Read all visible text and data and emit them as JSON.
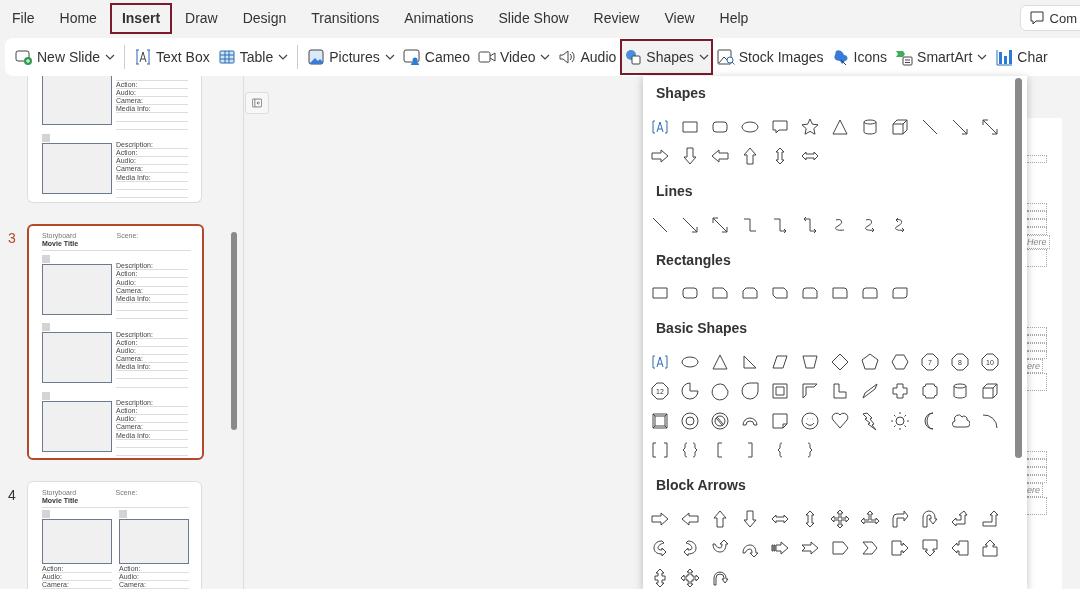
{
  "tabs": [
    {
      "label": "File",
      "selected": false
    },
    {
      "label": "Home",
      "selected": false
    },
    {
      "label": "Insert",
      "selected": true
    },
    {
      "label": "Draw",
      "selected": false
    },
    {
      "label": "Design",
      "selected": false
    },
    {
      "label": "Transitions",
      "selected": false
    },
    {
      "label": "Animations",
      "selected": false
    },
    {
      "label": "Slide Show",
      "selected": false
    },
    {
      "label": "Review",
      "selected": false
    },
    {
      "label": "View",
      "selected": false
    },
    {
      "label": "Help",
      "selected": false
    }
  ],
  "comments_button": {
    "label": "Com"
  },
  "ribbon": {
    "groups": [
      [
        {
          "label": "New Slide",
          "dropdown": true,
          "selected": false
        }
      ],
      [
        {
          "label": "Text Box",
          "dropdown": false,
          "selected": false
        },
        {
          "label": "Table",
          "dropdown": true,
          "selected": false
        }
      ],
      [
        {
          "label": "Pictures",
          "dropdown": true,
          "selected": false
        },
        {
          "label": "Cameo",
          "dropdown": false,
          "selected": false
        },
        {
          "label": "Video",
          "dropdown": true,
          "selected": false
        },
        {
          "label": "Audio",
          "dropdown": false,
          "selected": false
        },
        {
          "label": "Shapes",
          "dropdown": true,
          "selected": true
        },
        {
          "label": "Stock Images",
          "dropdown": false,
          "selected": false
        },
        {
          "label": "Icons",
          "dropdown": false,
          "selected": false
        },
        {
          "label": "SmartArt",
          "dropdown": true,
          "selected": false
        },
        {
          "label": "Char",
          "dropdown": false,
          "selected": false
        }
      ]
    ]
  },
  "slides": [
    {
      "selected": false,
      "kind": "rows",
      "frames": [
        {
          "fields": [
            "Action:",
            "Audio:",
            "Camera:",
            "Media Info:"
          ]
        },
        {
          "description": "Description:",
          "fields": [
            "Action:",
            "Audio:",
            "Camera:",
            "Media Info:"
          ]
        }
      ]
    },
    {
      "number": "3",
      "selected": true,
      "kind": "rows",
      "header": {
        "label": "Storyboard",
        "scene": "Scene:",
        "title": "Movie Title"
      },
      "frames": [
        {
          "description": "Description:",
          "fields": [
            "Action:",
            "Audio:",
            "Camera:",
            "Media Info:"
          ]
        },
        {
          "description": "Description:",
          "fields": [
            "Action:",
            "Audio:",
            "Camera:",
            "Media Info:"
          ]
        },
        {
          "description": "Description:",
          "fields": [
            "Action:",
            "Audio:",
            "Camera:",
            "Media Info:"
          ]
        }
      ]
    },
    {
      "number": "4",
      "selected": false,
      "kind": "columns",
      "header": {
        "label": "Storyboard",
        "scene": "Scene:",
        "title": "Movie Title"
      },
      "frames": [
        {
          "fields": [
            "Action:",
            "Audio:",
            "Camera:"
          ]
        },
        {
          "fields": [
            "Action:",
            "Audio:",
            "Camera:"
          ]
        }
      ]
    }
  ],
  "slide_canvas": {
    "placeholders": [
      "Here",
      "ere",
      "ere"
    ]
  },
  "shape_menu": {
    "sections": [
      {
        "title": "Shapes"
      },
      {
        "title": "Lines"
      },
      {
        "title": "Rectangles"
      },
      {
        "title": "Basic Shapes",
        "labels": [
          "7",
          "8",
          "10",
          "12"
        ]
      },
      {
        "title": "Block Arrows"
      }
    ]
  }
}
